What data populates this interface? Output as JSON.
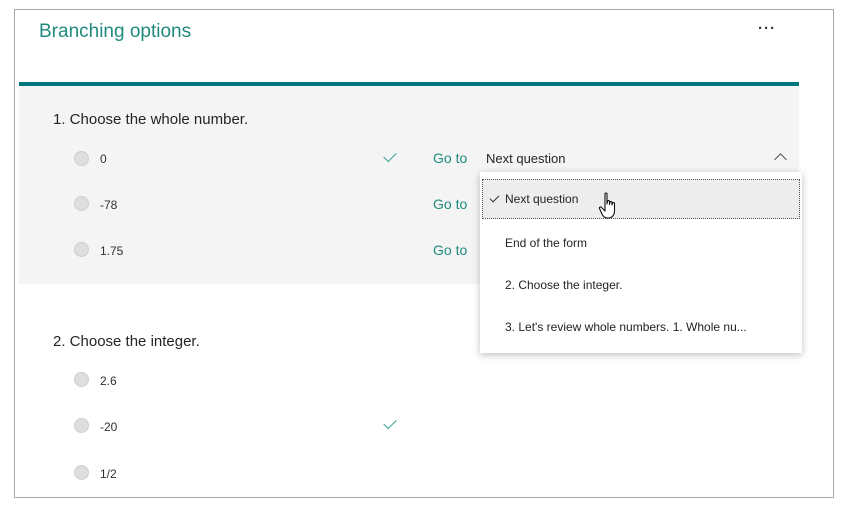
{
  "header": {
    "title": "Branching options",
    "more_label": "···"
  },
  "question1": {
    "title": "1. Choose the whole number.",
    "options": [
      {
        "label": "0",
        "goto": "Go to"
      },
      {
        "label": "-78",
        "goto": "Go to"
      },
      {
        "label": "1.75",
        "goto": "Go to"
      }
    ],
    "selected_value": "Next question"
  },
  "dropdown": {
    "items": [
      "Next question",
      "End of the form",
      "2. Choose the integer.",
      "3. Let's review whole numbers. 1. Whole nu..."
    ]
  },
  "question2": {
    "title": "2. Choose the integer.",
    "options": [
      {
        "label": "2.6"
      },
      {
        "label": "-20"
      },
      {
        "label": "1/2"
      }
    ]
  },
  "icons": {
    "check": "check-icon",
    "chevron": "chevron-up-icon",
    "cursor": "hand-cursor-icon",
    "more": "ellipsis-icon"
  },
  "colors": {
    "accent": "#03787c",
    "link": "#218a7e",
    "panel": "#f4f4f4"
  }
}
